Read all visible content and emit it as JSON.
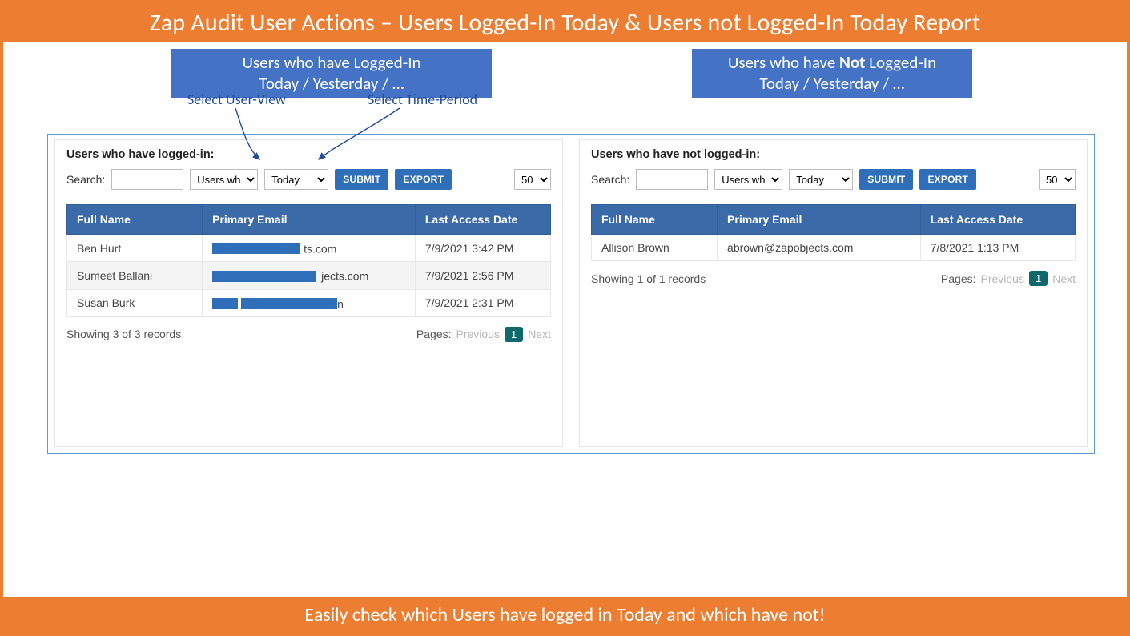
{
  "colors": {
    "accent": "#ED7D31",
    "banner": "#4472C4",
    "tableHeader": "#3B6AA8",
    "button": "#2F6FBA",
    "currentPage": "#0E6A6A",
    "panelBorder": "#5B9BD5"
  },
  "title": "Zap Audit User Actions – Users Logged-In Today & Users not Logged-In Today Report",
  "subLabels": {
    "left": {
      "line1": "Users who have Logged-In",
      "line2": "Today / Yesterday / …"
    },
    "right": {
      "prefix": "Users who have ",
      "bold": "Not",
      "suffix": " Logged-In",
      "line2": "Today / Yesterday / …"
    }
  },
  "annotations": {
    "userView": "Select User-View",
    "timePeriod": "Select Time-Period"
  },
  "common": {
    "searchLabel": "Search:",
    "userViewSelect": "Users wh",
    "periodSelect": "Today",
    "submit": "SUBMIT",
    "export": "EXPORT",
    "pageSize": "50",
    "columns": {
      "name": "Full Name",
      "email": "Primary Email",
      "access": "Last Access Date"
    },
    "pagesLabel": "Pages:",
    "prev": "Previous",
    "current": "1",
    "next": "Next"
  },
  "leftPanel": {
    "heading": "Users who have logged-in:",
    "rows": [
      {
        "name": "Ben Hurt",
        "emailTail": "ts.com",
        "access": "7/9/2021 3:42 PM",
        "redactStyle": "a"
      },
      {
        "name": "Sumeet Ballani",
        "emailTail": "jects.com",
        "access": "7/9/2021 2:56 PM",
        "redactStyle": "b"
      },
      {
        "name": "Susan Burk",
        "emailTail": "n",
        "access": "7/9/2021 2:31 PM",
        "redactStyle": "s"
      }
    ],
    "showing": "Showing 3 of 3 records"
  },
  "rightPanel": {
    "heading": "Users who have not logged-in:",
    "rows": [
      {
        "name": "Allison Brown",
        "email": "abrown@zapobjects.com",
        "access": "7/8/2021 1:13 PM"
      }
    ],
    "showing": "Showing 1 of 1 records"
  },
  "summary": "Easily check which Users have logged in Today and which have not!"
}
